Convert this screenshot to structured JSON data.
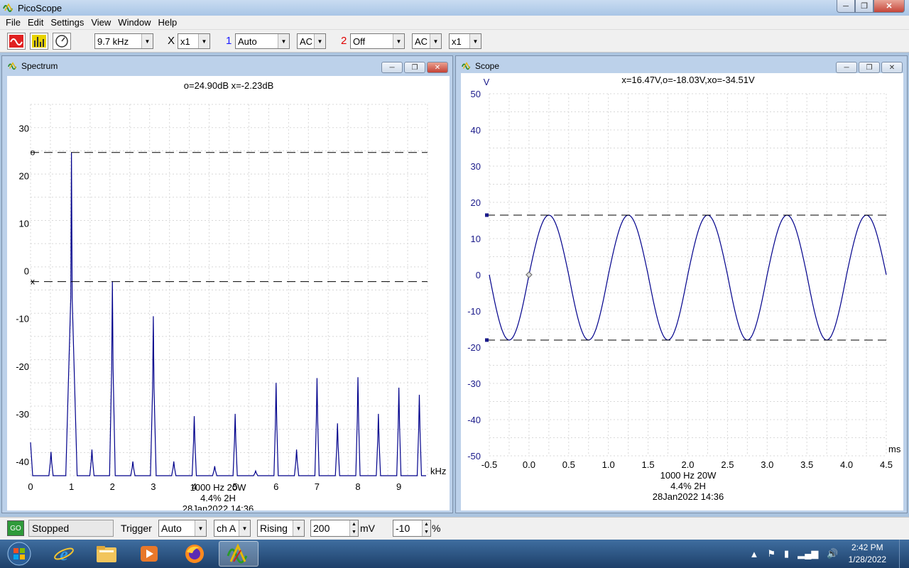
{
  "app": {
    "title": "PicoScope"
  },
  "menu": [
    "File",
    "Edit",
    "Settings",
    "View",
    "Window",
    "Help"
  ],
  "toolbar": {
    "timebase": "9.7 kHz",
    "x_mult_label": "X",
    "x_mult": "x1",
    "ch1_label": "1",
    "ch1_range": "Auto",
    "ch1_coupling": "AC",
    "ch2_label": "2",
    "ch2_range": "Off",
    "ch2_coupling": "AC",
    "ch2_mult": "x1",
    "colors": {
      "ch1": "#1a1aff",
      "ch2": "#e00000"
    }
  },
  "spectrum": {
    "title": "Spectrum",
    "readout": "o=24.90dB  x=-2.23dB",
    "footer": [
      "1000 Hz 20W",
      "4.4% 2H",
      "28Jan2022  14:36"
    ]
  },
  "scope": {
    "title": "Scope",
    "readout": "x=16.47V,o=-18.03V,xo=-34.51V",
    "footer": [
      "1000 Hz 20W",
      "4.4% 2H",
      "28Jan2022  14:36"
    ]
  },
  "chart_data": [
    {
      "type": "line",
      "title": "Spectrum",
      "xlabel": "kHz",
      "ylabel": "",
      "xlim": [
        0,
        9.7
      ],
      "ylim": [
        -43,
        35
      ],
      "x_ticks": [
        0,
        1,
        2,
        3,
        4,
        5,
        6,
        7,
        8,
        9
      ],
      "y_ticks": [
        30,
        20,
        10,
        0,
        -10,
        -20,
        -30,
        -40
      ],
      "grid": true,
      "floor_db": -43,
      "peaks": [
        {
          "x": 0.0,
          "y": -36
        },
        {
          "x": 0.5,
          "y": -38
        },
        {
          "x": 1.0,
          "y": 24.9
        },
        {
          "x": 1.5,
          "y": -37.5
        },
        {
          "x": 2.0,
          "y": -2.2
        },
        {
          "x": 2.5,
          "y": -40
        },
        {
          "x": 3.0,
          "y": -9.5
        },
        {
          "x": 3.5,
          "y": -40
        },
        {
          "x": 4.0,
          "y": -30.5
        },
        {
          "x": 4.5,
          "y": -41
        },
        {
          "x": 5.0,
          "y": -30
        },
        {
          "x": 5.5,
          "y": -42
        },
        {
          "x": 6.0,
          "y": -23.5
        },
        {
          "x": 6.5,
          "y": -37.5
        },
        {
          "x": 7.0,
          "y": -22.5
        },
        {
          "x": 7.5,
          "y": -32
        },
        {
          "x": 8.0,
          "y": -22.3
        },
        {
          "x": 8.5,
          "y": -30
        },
        {
          "x": 9.0,
          "y": -24.5
        },
        {
          "x": 9.5,
          "y": -26
        }
      ],
      "markers": [
        {
          "label": "o",
          "y": 24.9
        },
        {
          "label": "x",
          "y": -2.23
        }
      ],
      "series_color": "#00008b"
    },
    {
      "type": "line",
      "title": "Scope",
      "xlabel": "ms",
      "ylabel": "V",
      "xlim": [
        -0.5,
        4.5
      ],
      "ylim": [
        -50,
        50
      ],
      "x_ticks": [
        -0.5,
        0.0,
        0.5,
        1.0,
        1.5,
        2.0,
        2.5,
        3.0,
        3.5,
        4.0,
        4.5
      ],
      "x_tick_labels": [
        "-0.5",
        "0.0",
        "0.5",
        "1.0",
        "1.5",
        "2.0",
        "2.5",
        "3.0",
        "3.5",
        "4.0",
        "4.5"
      ],
      "y_ticks": [
        50,
        40,
        30,
        20,
        10,
        0,
        -10,
        -20,
        -30,
        -40,
        -50
      ],
      "grid": true,
      "sine": {
        "frequency_khz": 1.0,
        "amplitude_pos": 16.47,
        "amplitude_neg": -18.03,
        "zero_cross_ms": 0.0
      },
      "markers": [
        {
          "label": "x",
          "y": 16.47
        },
        {
          "label": "o",
          "y": -18.03
        }
      ],
      "trigger_point": {
        "x": 0.0,
        "y": 0
      },
      "series_color": "#00008b"
    }
  ],
  "status": {
    "state": "Stopped",
    "go_label": "GO",
    "trigger_label": "Trigger",
    "trigger_mode": "Auto",
    "trigger_channel": "ch A",
    "trigger_edge": "Rising",
    "trigger_level": "200",
    "trigger_level_unit": "mV",
    "pretrigger": "-10",
    "pretrigger_unit": "%"
  },
  "taskbar": {
    "time": "2:42 PM",
    "date": "1/28/2022"
  }
}
